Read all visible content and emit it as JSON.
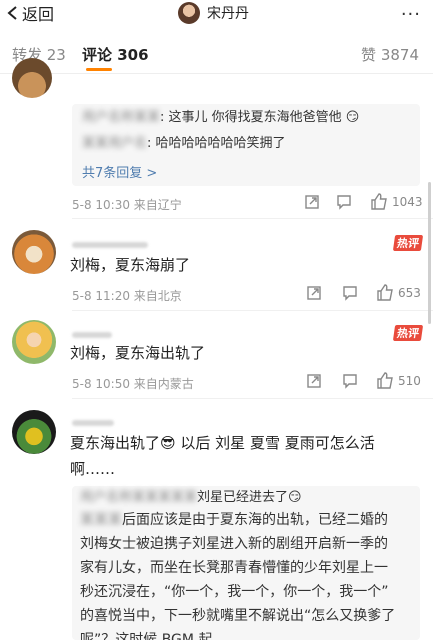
{
  "nav": {
    "back_label": "返回",
    "user_name": "宋丹丹",
    "more_label": "···"
  },
  "tabs": {
    "repost": "转发 23",
    "comments": "评论 306",
    "likes": "赞 3874"
  },
  "comments": [
    {
      "replies": [
        {
          "text": ": 这事儿 你得找夏东海他爸管他"
        },
        {
          "text": ": 哈哈哈哈哈哈哈笑拥了"
        }
      ],
      "more_replies": "共7条回复 >",
      "meta": "5-8 10:30  来自辽宁",
      "like_count": "1043"
    },
    {
      "text": "刘梅，夏东海崩了",
      "meta": "5-8 11:20  来自北京",
      "like_count": "653",
      "badge": "热评"
    },
    {
      "text": "刘梅，夏东海出轨了",
      "meta": "5-8 10:50  来自内蒙古",
      "like_count": "510",
      "badge": "热评"
    },
    {
      "text_line1": "夏东海出轨了😎 以后 刘星 夏雪 夏雨可怎么活",
      "text_line2": "啊……",
      "reply_line1": "刘星已经进去了😏",
      "reply_lines": [
        "后面应该是由于夏东海的出轨，已经二婚的",
        "刘梅女士被迫携子刘星进入新的剧组开启新一季的",
        "家有儿女，而坐在长凳那青春懵懂的少年刘星上一",
        "秒还沉浸在，“你一个，我一个，你一个，我一个”",
        "的喜悦当中，下一秒就嘴里不解说出“怎么又换爹了",
        "呢”？这时候 BGM 起"
      ]
    }
  ]
}
